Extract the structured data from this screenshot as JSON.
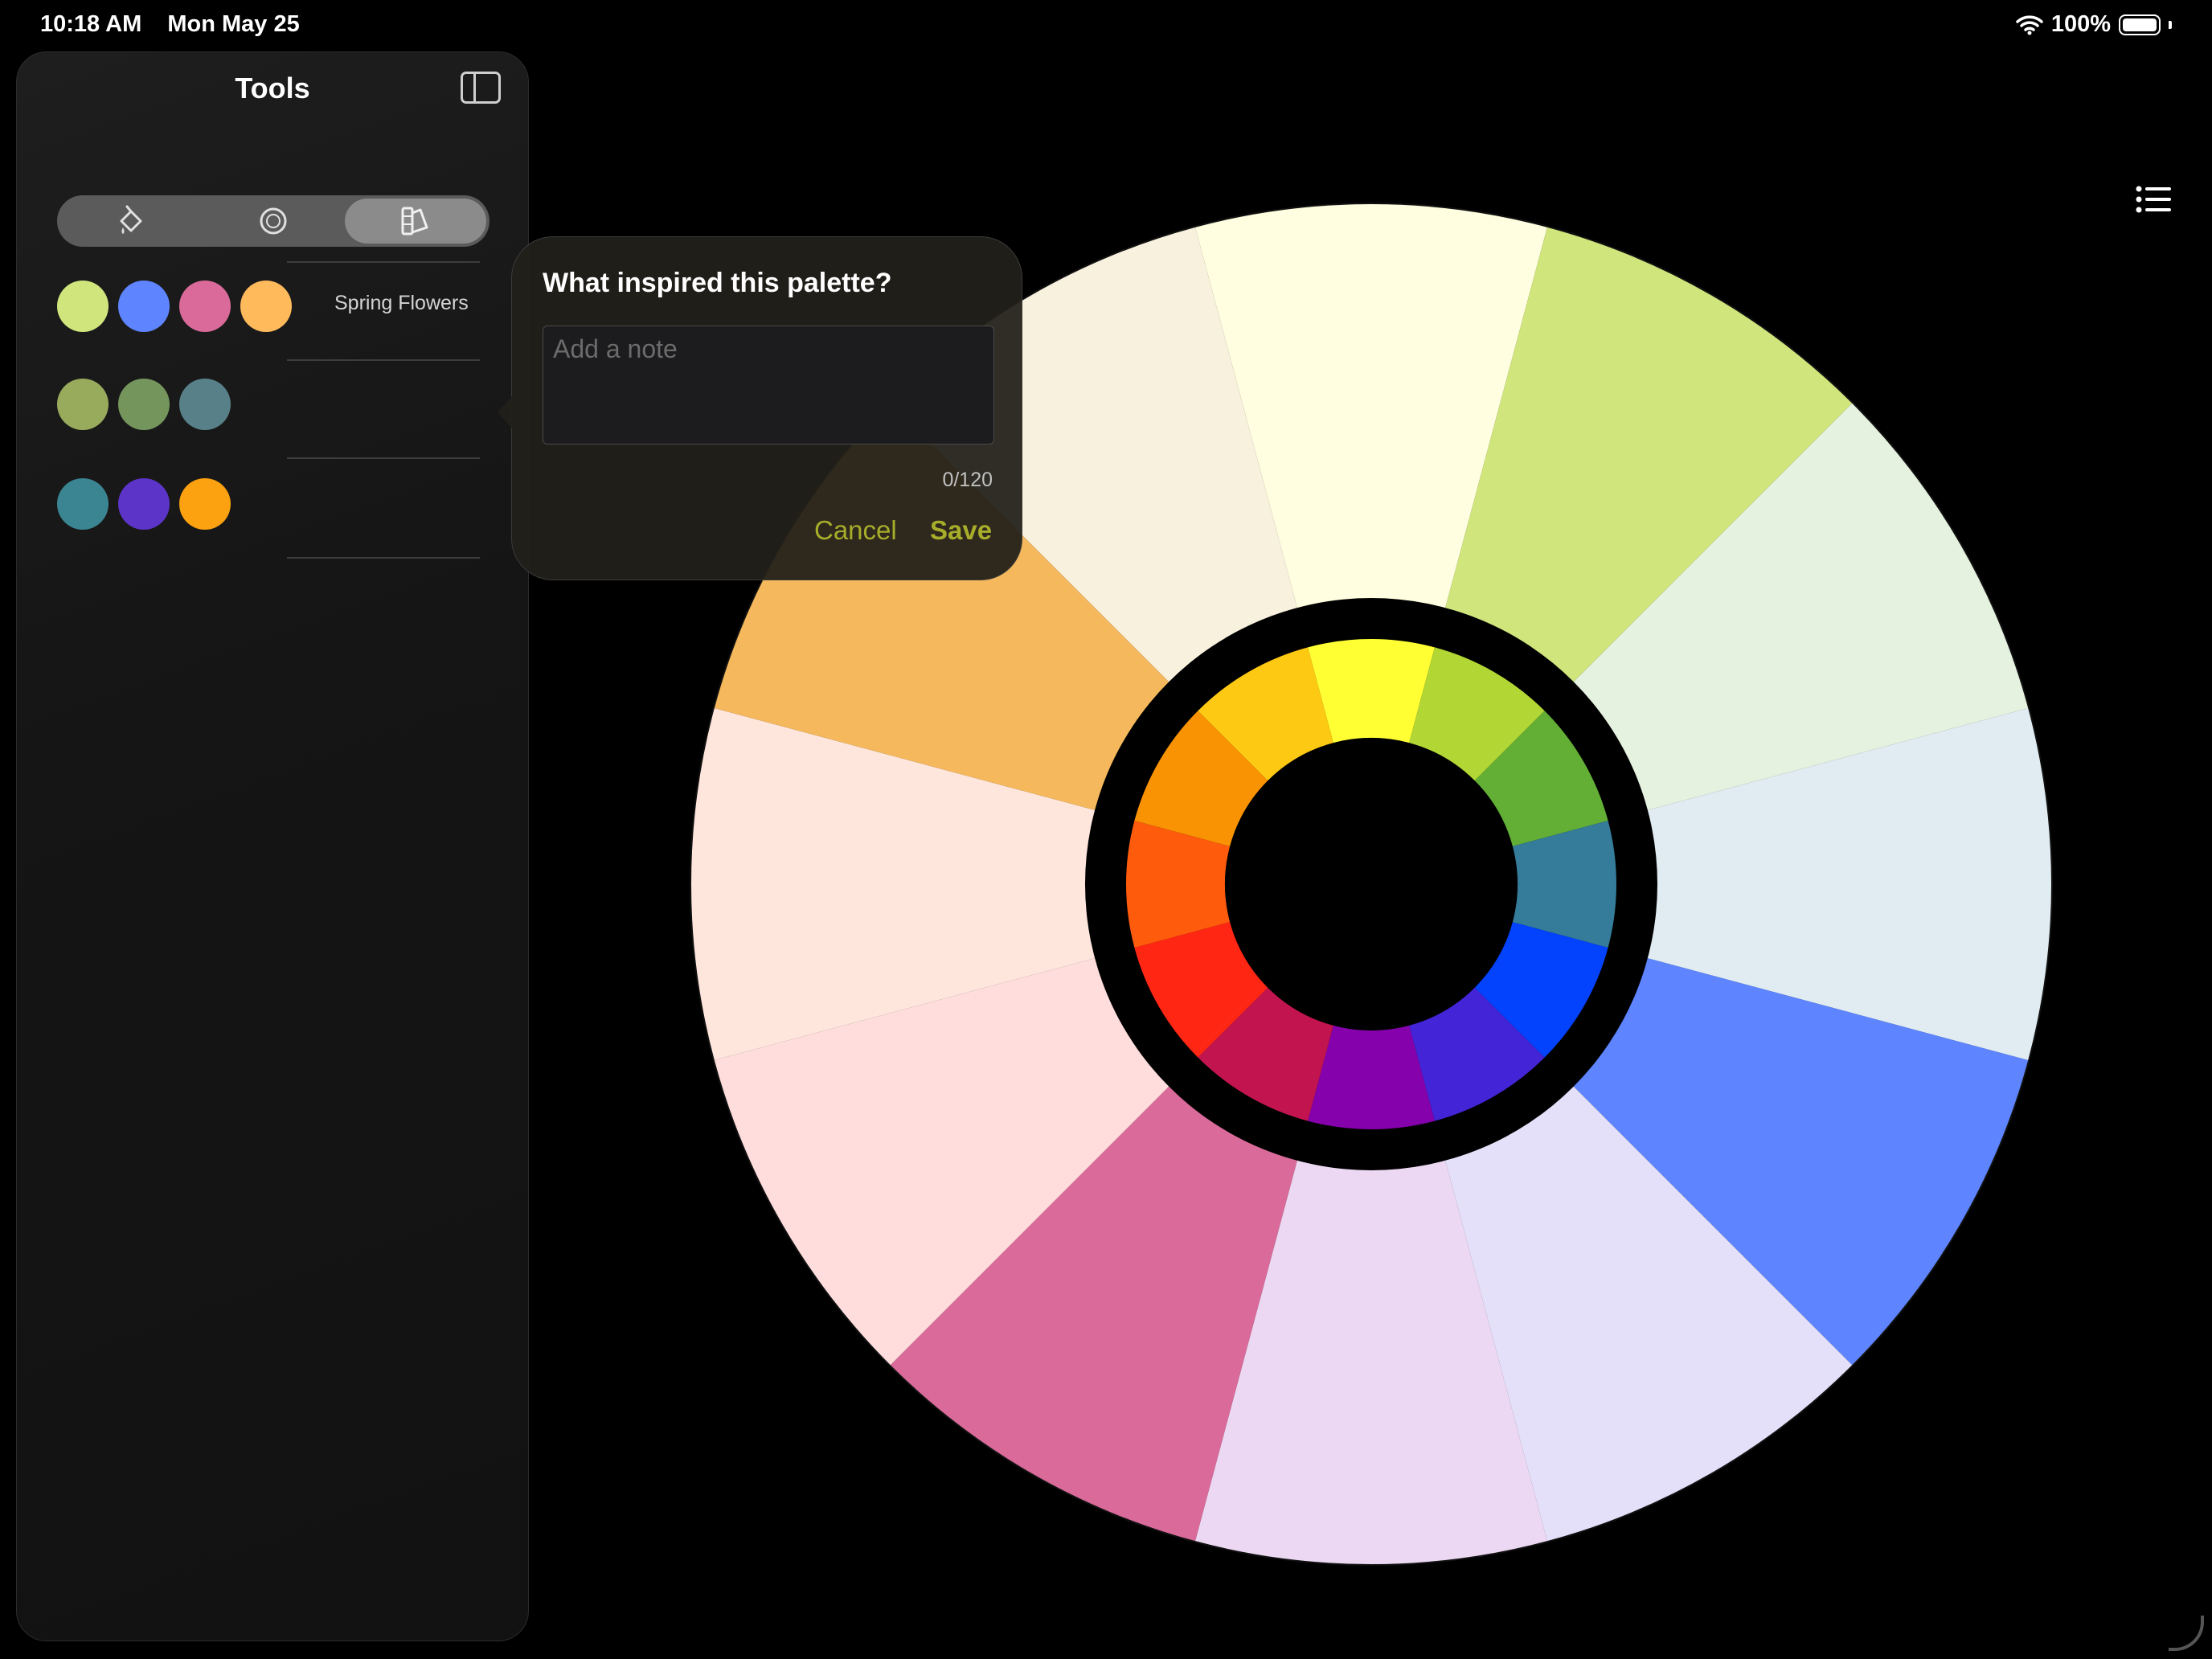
{
  "status": {
    "time": "10:18 AM",
    "date": "Mon May 25",
    "battery": "100%"
  },
  "sidebar": {
    "title": "Tools",
    "segments": [
      {
        "icon": "paint-bucket-icon",
        "selected": false
      },
      {
        "icon": "circle-target-icon",
        "selected": false
      },
      {
        "icon": "swatch-book-icon",
        "selected": true
      }
    ],
    "palettes": [
      {
        "name": "Spring Flowers",
        "colors": [
          "#d0e57c",
          "#5e85ff",
          "#d96a99",
          "#ffba5c"
        ]
      },
      {
        "name": "",
        "colors": [
          "#98aa5c",
          "#74955c",
          "#588088"
        ]
      },
      {
        "name": "",
        "colors": [
          "#3b8592",
          "#5c34c7",
          "#fca110"
        ]
      }
    ]
  },
  "popover": {
    "title": "What inspired this palette?",
    "note_placeholder": "Add a note",
    "note_value": "",
    "char_count": "0/120",
    "cancel_label": "Cancel",
    "save_label": "Save",
    "accent_color": "#a7ad2a"
  },
  "color_wheel": {
    "outer_segments": [
      "#fffee0",
      "#d0e57c",
      "#e6f2e0",
      "#e0ecf2",
      "#5e85ff",
      "#e4e0fa",
      "#edd8f3",
      "#d96a99",
      "#ffdddd",
      "#ffe6dd",
      "#f5b85c",
      "#f8f1de"
    ],
    "inner_segments": [
      "#ffff33",
      "#b2d634",
      "#63ae35",
      "#347c99",
      "#0343fd",
      "#4324d6",
      "#8501ac",
      "#c2144f",
      "#ff2614",
      "#ff5b0c",
      "#fa9303",
      "#fec913"
    ]
  },
  "toolbar": {
    "list_icon": "list-icon"
  }
}
